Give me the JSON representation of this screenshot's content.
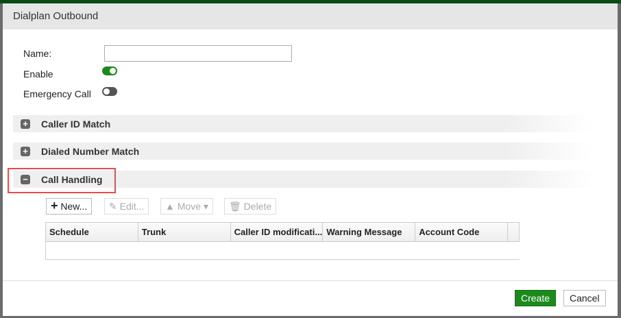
{
  "dialog": {
    "title": "Dialplan Outbound"
  },
  "form": {
    "name_label": "Name:",
    "name_value": "",
    "enable_label": "Enable",
    "enable_on": true,
    "emergency_label": "Emergency Call",
    "emergency_on": false
  },
  "sections": [
    {
      "label": "Caller ID Match",
      "expanded": false
    },
    {
      "label": "Dialed Number Match",
      "expanded": false
    },
    {
      "label": "Call Handling",
      "expanded": true
    }
  ],
  "toolbar": {
    "new": "New...",
    "edit": "Edit...",
    "move": "Move",
    "delete": "Delete"
  },
  "table": {
    "columns": [
      "Schedule",
      "Trunk",
      "Caller ID modificati...",
      "Warning Message",
      "Account Code"
    ]
  },
  "footer": {
    "create": "Create",
    "cancel": "Cancel"
  },
  "colors": {
    "accent": "#1b8a1b",
    "highlight": "#e94a4a"
  }
}
